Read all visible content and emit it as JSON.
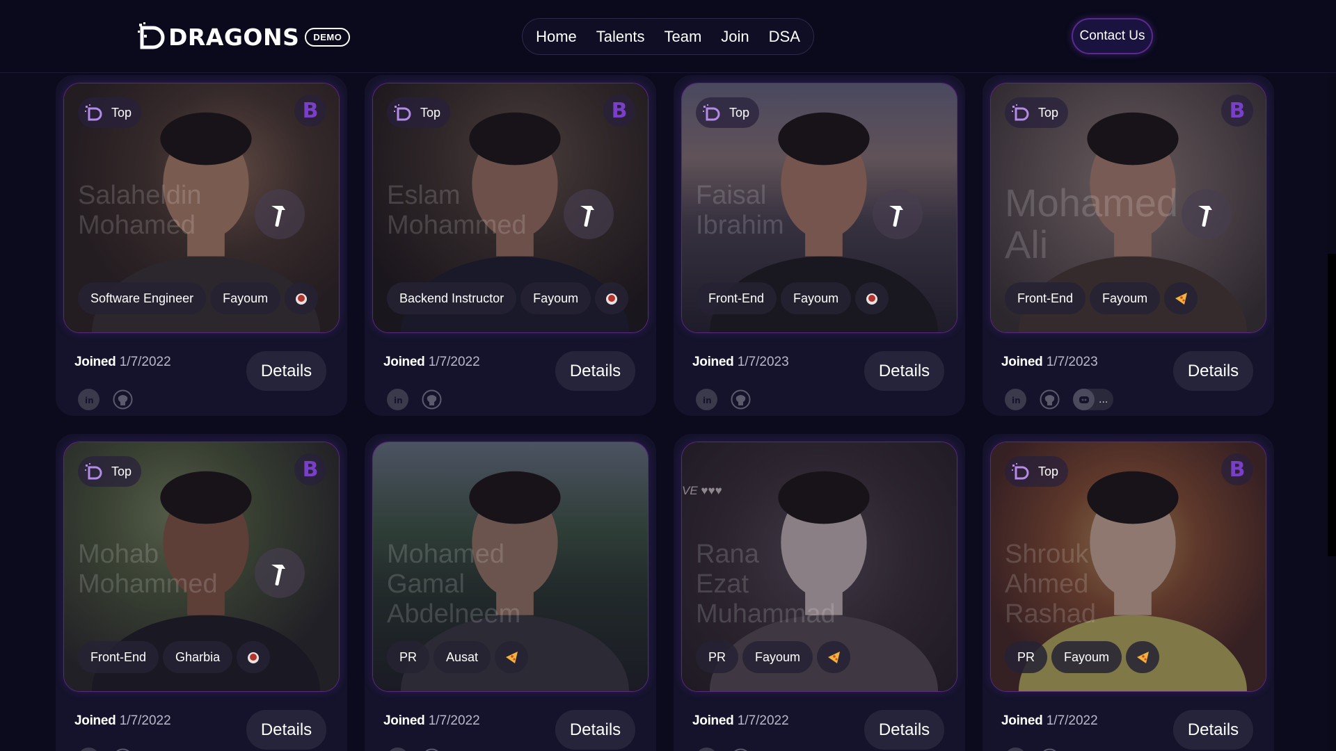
{
  "header": {
    "logo_text": "DRAGONS",
    "demo_label": "DEMO",
    "nav": [
      "Home",
      "Talents",
      "Team",
      "Join",
      "DSA"
    ],
    "contact_label": "Contact Us"
  },
  "top_label": "Top",
  "b_label": "B",
  "details_label": "Details",
  "joined_label": "Joined",
  "more_label": "...",
  "cards": [
    {
      "name": "Salaheldin Mohamed",
      "tags": [
        "Software Engineer",
        "Fayoum"
      ],
      "badge_icon": "coffee-icon",
      "top": true,
      "b": true,
      "hammer": true,
      "joined": "1/7/2022",
      "more": false
    },
    {
      "name": "Eslam Mohammed",
      "tags": [
        "Backend Instructor",
        "Fayoum"
      ],
      "badge_icon": "coffee-icon",
      "top": true,
      "b": true,
      "hammer": true,
      "joined": "1/7/2022",
      "more": false
    },
    {
      "name": "Faisal Ibrahim",
      "tags": [
        "Front-End",
        "Fayoum"
      ],
      "badge_icon": "coffee-icon",
      "top": true,
      "b": false,
      "hammer": true,
      "joined": "1/7/2023",
      "more": false
    },
    {
      "name": "Mohamed Ali",
      "tags": [
        "Front-End",
        "Fayoum"
      ],
      "badge_icon": "pizza-icon",
      "top": true,
      "b": true,
      "hammer": true,
      "joined": "1/7/2023",
      "more": true
    },
    {
      "name": "Mohab Mohammed",
      "tags": [
        "Front-End",
        "Gharbia"
      ],
      "badge_icon": "coffee-icon",
      "top": true,
      "b": true,
      "hammer": true,
      "joined": "1/7/2022",
      "more": false
    },
    {
      "name": "Mohamed Gamal Abdelneem",
      "tags": [
        "PR",
        "Ausat"
      ],
      "badge_icon": "pizza-icon",
      "top": false,
      "b": false,
      "hammer": false,
      "joined": "1/7/2022",
      "more": false
    },
    {
      "name": "Rana Ezat Muhammad",
      "tags": [
        "PR",
        "Fayoum"
      ],
      "badge_icon": "pizza-icon",
      "top": false,
      "b": false,
      "hammer": false,
      "joined": "1/7/2022",
      "more": false
    },
    {
      "name": "Shrouk Ahmed Rashad",
      "tags": [
        "PR",
        "Fayoum"
      ],
      "badge_icon": "pizza-icon",
      "top": true,
      "b": true,
      "hammer": false,
      "joined": "1/7/2022",
      "more": false
    }
  ],
  "photo_overlay_text": "VE ♥♥♥",
  "colors": {
    "background": "#0c0b1e",
    "card": "#14132b",
    "accent": "#7a3fc7",
    "border": "#5a2a7d"
  }
}
